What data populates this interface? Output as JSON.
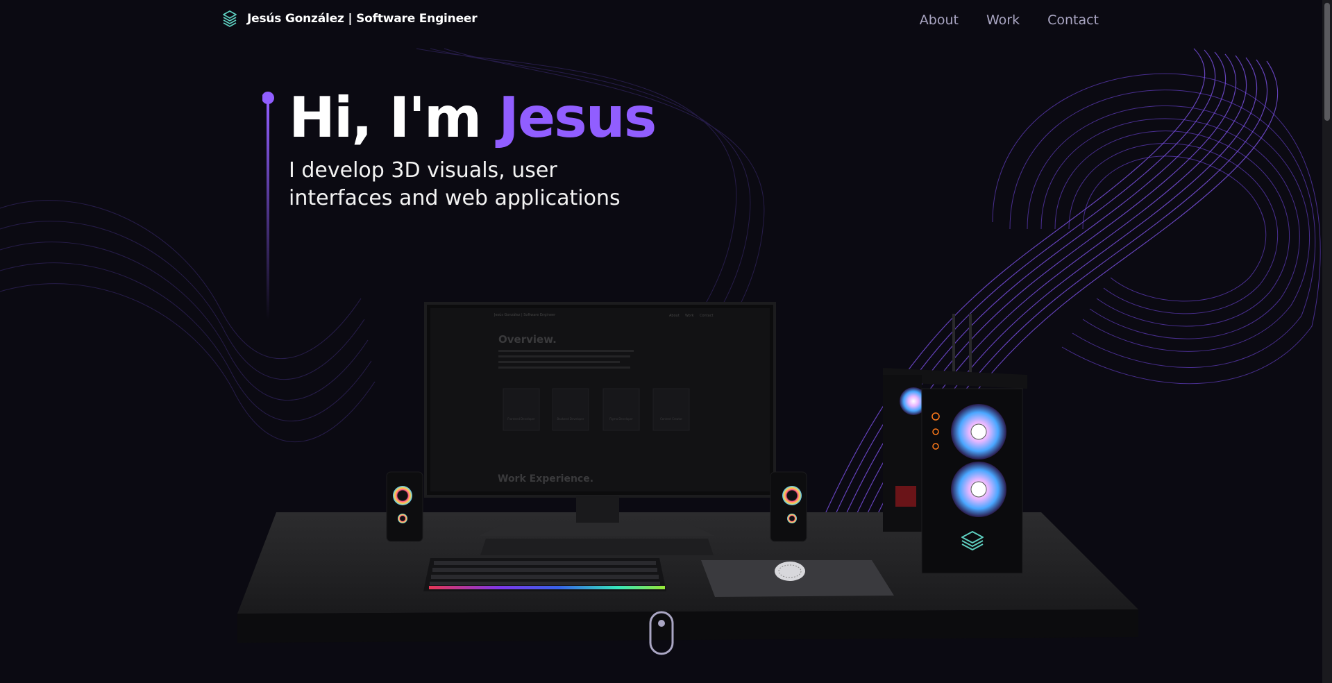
{
  "navbar": {
    "brand_name": "Jesús González",
    "brand_role": "| Software Engineer",
    "links": [
      "About",
      "Work",
      "Contact"
    ]
  },
  "hero": {
    "title_prefix": "Hi, I'm ",
    "title_name": "Jesus",
    "subtitle_line1": "I develop 3D visuals, user",
    "subtitle_line2": "interfaces and web applications"
  },
  "monitor_screen": {
    "brand": "Jesús González | Software Engineer",
    "links": [
      "About",
      "Work",
      "Contact"
    ],
    "overview_title": "Overview.",
    "cards": [
      "Frontend Developer",
      "Backend Developer",
      "Figma Developer",
      "Content Creator"
    ],
    "work_title": "Work Experience."
  },
  "colors": {
    "background": "#0b0a12",
    "accent": "#915eff",
    "logo": "#5ecfc0",
    "nav_text": "#aaa6c3"
  },
  "icons": {
    "logo": "layered-hexagon-logo-icon",
    "scroll": "mouse-scroll-icon"
  }
}
